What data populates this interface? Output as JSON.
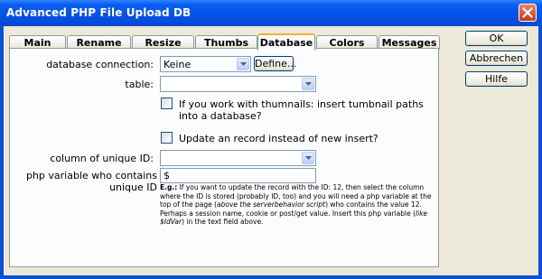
{
  "window": {
    "title": "Advanced PHP File Upload DB"
  },
  "tabs": [
    "Main",
    "Rename",
    "Resize",
    "Thumbs",
    "Database",
    "Colors",
    "Messages"
  ],
  "active_tab": "Database",
  "form": {
    "db_connection_label": "database connection:",
    "db_connection_value": "Keine",
    "define_button": "Define...",
    "table_label": "table:",
    "table_value": "",
    "thumbs_checkbox_label": "If you work with thumnails: insert tumbnail paths into a database?",
    "update_checkbox_label": "Update an record instead of new insert?",
    "unique_id_label": "column of unique ID:",
    "unique_id_value": "",
    "php_var_label": "php variable who contains unique ID",
    "php_var_value": "$"
  },
  "help": {
    "eg": "E.g.:",
    "text1": " If you want to update the record with the ID: 12, then select the column where the ID is stored (probably ID, too) and you will need a php variable at the top of the page (",
    "ital1": "above the serverbehavior script",
    "text2": ") who contains the value 12. Perhaps a session name, cookie or post/get value. Insert this php variable (",
    "ital2": "like $IdVar",
    "text3": ") in the text field above."
  },
  "buttons": {
    "ok": "OK",
    "cancel": "Abbrechen",
    "help": "Hilfe"
  },
  "colors": {
    "titlebar": "#0653e6",
    "dialog_bg": "#ece9d8",
    "active_tab_accent": "#f8b034"
  }
}
